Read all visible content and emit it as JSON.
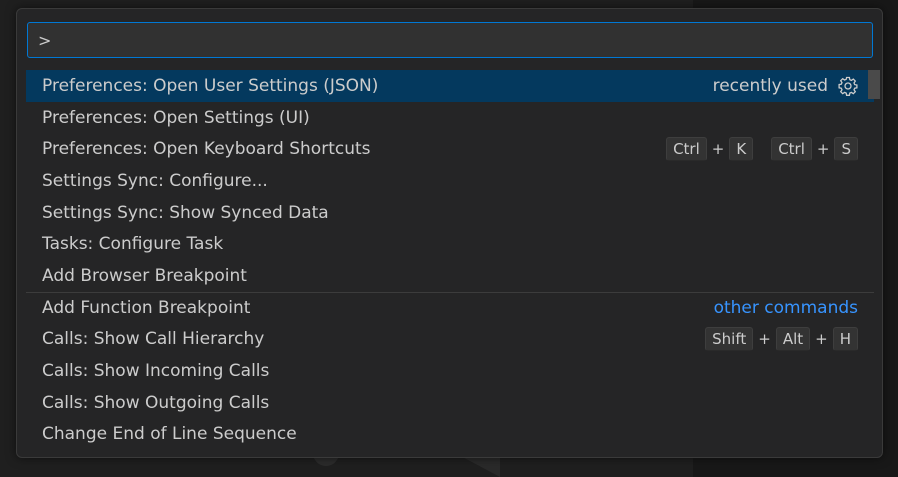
{
  "quick_input": {
    "value": ">",
    "rows": [
      {
        "label": "Preferences: Open User Settings (JSON)",
        "detail": "recently used",
        "gear_icon": "gear-icon",
        "selected": true
      },
      {
        "label": "Preferences: Open Settings (UI)"
      },
      {
        "label": "Preferences: Open Keyboard Shortcuts",
        "keybinding": [
          [
            "Ctrl",
            "K"
          ],
          [
            "Ctrl",
            "S"
          ]
        ]
      },
      {
        "label": "Settings Sync: Configure..."
      },
      {
        "label": "Settings Sync: Show Synced Data"
      },
      {
        "label": "Tasks: Configure Task"
      },
      {
        "label": "Add Browser Breakpoint"
      },
      {
        "label": "Add Function Breakpoint",
        "separator_label": "other commands"
      },
      {
        "label": "Calls: Show Call Hierarchy",
        "keybinding": [
          [
            "Shift",
            "Alt",
            "H"
          ]
        ]
      },
      {
        "label": "Calls: Show Incoming Calls"
      },
      {
        "label": "Calls: Show Outgoing Calls"
      },
      {
        "label": "Change End of Line Sequence"
      }
    ],
    "plus_sign": "+"
  },
  "colors": {
    "background": "#1f1f1f",
    "widget": "#252526",
    "selected_row": "#04395e",
    "focus_border": "#0078d4",
    "link": "#3794ff"
  }
}
